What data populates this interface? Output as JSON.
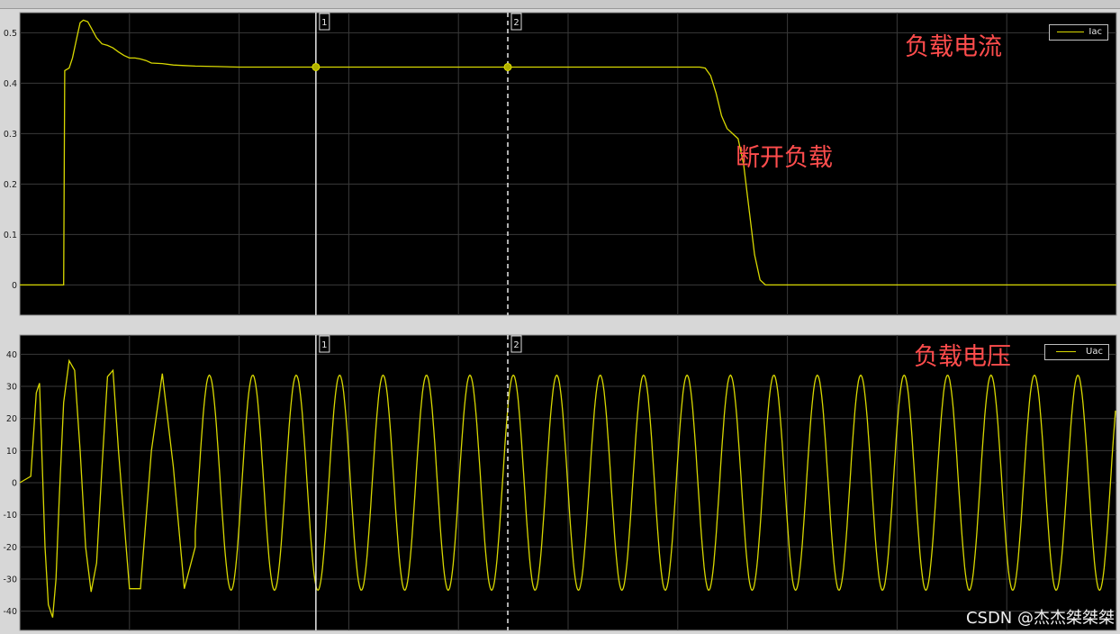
{
  "chart_data": [
    {
      "type": "line",
      "title": "",
      "xlabel": "",
      "ylabel": "",
      "xlim": [
        0,
        1
      ],
      "ylim": [
        -0.06,
        0.54
      ],
      "ticks_y": [
        "0",
        "0.1",
        "0.2",
        "0.3",
        "0.4",
        "0.5"
      ],
      "grid": true,
      "legend": "top-right",
      "series": [
        {
          "name": "Iac",
          "x": [
            0,
            0.04,
            0.041,
            0.045,
            0.048,
            0.052,
            0.055,
            0.058,
            0.062,
            0.065,
            0.07,
            0.075,
            0.08,
            0.085,
            0.09,
            0.095,
            0.1,
            0.105,
            0.11,
            0.115,
            0.12,
            0.13,
            0.14,
            0.15,
            0.16,
            0.18,
            0.2,
            0.24,
            0.3,
            0.4,
            0.5,
            0.6,
            0.6,
            0.62,
            0.625,
            0.63,
            0.635,
            0.64,
            0.645,
            0.65,
            0.655,
            0.66,
            0.665,
            0.67,
            0.675,
            0.68,
            0.7,
            0.8,
            0.9,
            1.0
          ],
          "values": [
            0,
            0,
            0.425,
            0.43,
            0.45,
            0.49,
            0.52,
            0.525,
            0.522,
            0.51,
            0.49,
            0.478,
            0.475,
            0.47,
            0.462,
            0.455,
            0.45,
            0.45,
            0.448,
            0.445,
            0.44,
            0.439,
            0.436,
            0.435,
            0.434,
            0.433,
            0.432,
            0.432,
            0.432,
            0.432,
            0.432,
            0.432,
            0.432,
            0.432,
            0.43,
            0.415,
            0.38,
            0.335,
            0.31,
            0.3,
            0.29,
            0.24,
            0.15,
            0.06,
            0.01,
            0,
            0,
            0,
            0,
            0
          ]
        }
      ],
      "cursors": [
        {
          "label": "1",
          "x": 0.27
        },
        {
          "label": "2",
          "x": 0.445
        }
      ]
    },
    {
      "type": "line",
      "title": "",
      "xlabel": "",
      "ylabel": "",
      "xlim": [
        0,
        1
      ],
      "ylim": [
        -46,
        46
      ],
      "ticks_y": [
        "40",
        "30",
        "20",
        "10",
        "0",
        "-10",
        "-20",
        "-30",
        "-40"
      ],
      "grid": true,
      "legend": "top-right",
      "series": [
        {
          "name": "Uac",
          "x": [
            0,
            0.01,
            0.015,
            0.018,
            0.02,
            0.023,
            0.026,
            0.03,
            0.033,
            0.036,
            0.04,
            0.045,
            0.05,
            0.055,
            0.06,
            0.065,
            0.07,
            0.075,
            0.08,
            0.085,
            0.09,
            0.1,
            0.11,
            0.12,
            0.13,
            0.14,
            0.15,
            0.16
          ],
          "values": [
            0,
            2,
            28,
            31,
            10,
            -20,
            -38,
            -42,
            -30,
            -5,
            25,
            38,
            35,
            10,
            -20,
            -34,
            -25,
            5,
            33,
            35,
            10,
            -33,
            -33,
            10,
            34,
            5,
            -33,
            -20
          ],
          "sine": {
            "amplitude": 33.5,
            "period": 0.0396,
            "start": 0.16
          }
        }
      ],
      "cursors": [
        {
          "label": "1",
          "x": 0.27
        },
        {
          "label": "2",
          "x": 0.445
        }
      ]
    }
  ],
  "annotations": {
    "load_current": "负载电流",
    "disconnect_load": "断开负载",
    "load_voltage": "负载电压"
  },
  "watermark": "CSDN @杰杰桀桀桀",
  "colors": {
    "background": "#000000",
    "trace": "#d8d800",
    "grid": "#3a3a3a",
    "annotation": "#ff4d4d"
  }
}
